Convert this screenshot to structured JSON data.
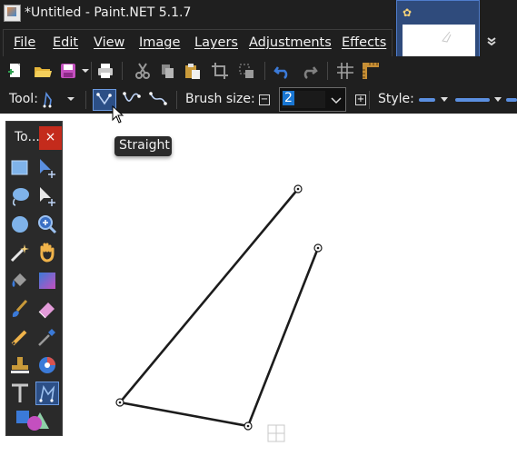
{
  "window": {
    "title": "*Untitled - Paint.NET 5.1.7"
  },
  "menu": {
    "file": "File",
    "edit": "Edit",
    "view": "View",
    "image": "Image",
    "layers": "Layers",
    "adjustments": "Adjustments",
    "effects": "Effects"
  },
  "toolbar": {
    "icons": [
      "new-file-icon",
      "open-icon",
      "save-icon",
      "print-icon",
      "cut-icon",
      "copy-icon",
      "paste-icon",
      "crop-icon",
      "deselect-icon",
      "undo-icon",
      "redo-icon",
      "grid-icon",
      "ruler-icon"
    ]
  },
  "options": {
    "tool_label": "Tool:",
    "brush_label": "Brush size:",
    "brush_value": "2",
    "style_label": "Style:"
  },
  "tooltip": {
    "text": "Straight"
  },
  "tools_window": {
    "title": "To...",
    "close": "×",
    "tools": [
      "rectangle-select-icon",
      "move-selection-icon",
      "lasso-select-icon",
      "move-selected-icon",
      "ellipse-select-icon",
      "zoom-icon",
      "magic-wand-icon",
      "pan-icon",
      "paint-bucket-icon",
      "gradient-icon",
      "paintbrush-icon",
      "eraser-icon",
      "pencil-icon",
      "color-picker-icon",
      "clone-stamp-icon",
      "recolor-icon",
      "text-icon",
      "line-curve-icon",
      "shapes-icon"
    ]
  },
  "colors": {
    "accent": "#2c4f86",
    "bg": "#1f1f1f",
    "close": "#c42b1c"
  }
}
